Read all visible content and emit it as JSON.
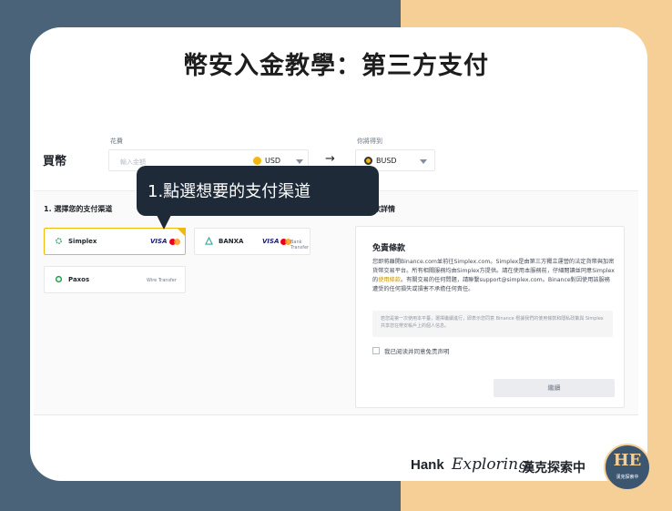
{
  "headline": "幣安入金教學：第三方支付",
  "buy": {
    "title": "買幣",
    "spend_label": "花費",
    "spend_placeholder": "輸入金額",
    "spend_currency": "USD",
    "get_label": "你將得到",
    "get_currency": "BUSD"
  },
  "sections": {
    "methods_title": "1. 選擇您的支付渠道",
    "details_title": "款詳情"
  },
  "methods": [
    {
      "name": "Simplex",
      "visa": "VISA",
      "selected": true
    },
    {
      "name": "BANXA",
      "visa": "VISA",
      "extra": "Bank Transfer"
    },
    {
      "name": "Paxos",
      "extra": "Wire Transfer"
    }
  ],
  "panel": {
    "title": "免責條款",
    "body_a": "您即將離開Binance.com並前往Simplex.com。Simplex是由第三方獨立運營的法定貨幣與加密貨幣交易平台。所有相關服務均由Simplex方提供。請在使用本服務前，仔細閱讀並同意Simplex的",
    "link": "使用條款",
    "body_b": "。有關交易的任何問題，請聯繫support@simplex.com。Binance對因使用該服務遭受的任何損失或損害不承擔任何責任。",
    "note": "若您是第一次使用本平臺，選擇繼續進行，即表示您同意 Binance 根據我們的使用條款和隱私政策與 Simplex 共享您在幣安帳戶上的個人信息。",
    "checkbox_label": "我已阅读并同意免责声明",
    "continue_button": "繼續"
  },
  "tooltip": "1.點選想要的支付渠道",
  "brand": {
    "hank": "Hank",
    "exploring": "Exploring",
    "cn": "漢克探索中",
    "logo_mark": "HE",
    "logo_sub": "漢克探索中"
  },
  "colors": {
    "accent": "#f0b90b",
    "bg_left": "#4b6379",
    "bg_right": "#f6cf96",
    "tooltip_bg": "#1e2a38"
  }
}
